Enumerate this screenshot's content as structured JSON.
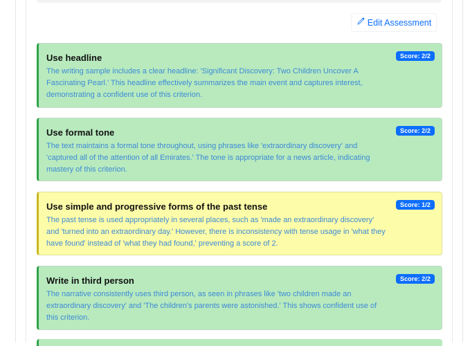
{
  "header": {
    "edit_label": "Edit Assessment"
  },
  "criteria": [
    {
      "title": "Use headline",
      "score": "Score: 2/2",
      "text": "The writing sample includes a clear headline: 'Significant Discovery: Two Children Uncover A Fascinating Pearl.' This headline effectively summarizes the main event and captures interest, demonstrating a confident use of this criterion.",
      "status_color": "#2fa24a"
    },
    {
      "title": "Use formal tone",
      "score": "Score: 2/2",
      "text": "The text maintains a formal tone throughout, using phrases like 'extraordinary discovery' and 'captured all of the attention of all Emirates.' The tone is appropriate for a news article, indicating mastery of this criterion.",
      "status_color": "#2fa24a"
    },
    {
      "title": "Use simple and progressive forms of the past tense",
      "score": "Score: 1/2",
      "text": "The past tense is used appropriately in several places, such as 'made an extraordinary discovery' and 'turned into an extraordinary day.' However, there is inconsistency with tense usage in 'what they have found' instead of 'what they had found,' preventing a score of 2.",
      "status_color": "#c9b723"
    },
    {
      "title": "Write in third person",
      "score": "Score: 2/2",
      "text": "The narrative consistently uses third person, as seen in phrases like 'two children made an extraordinary discovery' and 'The children's parents were astonished.' This shows confident use of this criterion.",
      "status_color": "#2fa24a"
    }
  ]
}
